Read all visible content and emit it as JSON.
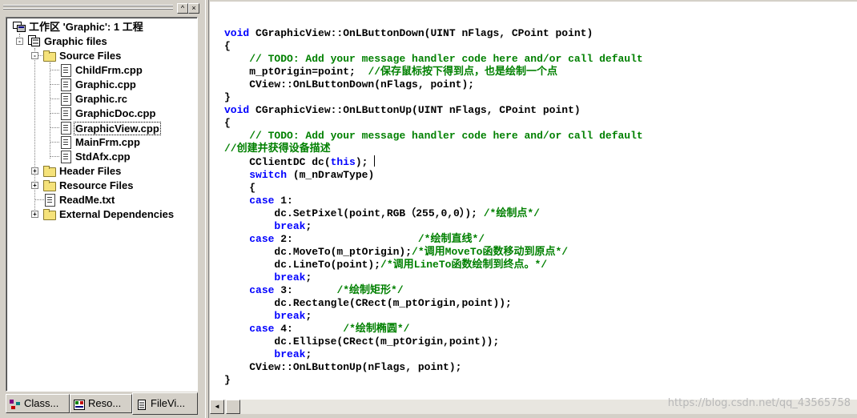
{
  "workspace": {
    "close_btn": "×",
    "pin_btn": "^",
    "root": "工作区 'Graphic': 1 工程",
    "project": "Graphic files",
    "source_folder": "Source Files",
    "source_files": [
      "ChildFrm.cpp",
      "Graphic.cpp",
      "Graphic.rc",
      "GraphicDoc.cpp",
      "GraphicView.cpp",
      "MainFrm.cpp",
      "StdAfx.cpp"
    ],
    "header_folder": "Header Files",
    "resource_folder": "Resource Files",
    "readme": "ReadMe.txt",
    "deps_folder": "External Dependencies",
    "expanded": "-",
    "collapsed": "+"
  },
  "tabs": [
    {
      "label": "Class...",
      "icon": "classview-icon"
    },
    {
      "label": "Reso...",
      "icon": "resourceview-icon"
    },
    {
      "label": "FileVi...",
      "icon": "fileview-icon"
    }
  ],
  "editor": {
    "lines": [
      [
        {
          "t": "void",
          "c": "kw"
        },
        {
          "t": " CGraphicView::OnLButtonDown(UINT nFlags, CPoint point)"
        }
      ],
      [
        {
          "t": "{"
        }
      ],
      [
        {
          "t": "    "
        },
        {
          "t": "// TODO: Add your message handler code here and/or call default",
          "c": "cm"
        }
      ],
      [
        {
          "t": "    m_ptOrigin=point;  "
        },
        {
          "t": "//保存鼠标按下得到点，也是绘制一个点",
          "c": "cm"
        }
      ],
      [
        {
          "t": "    CView::OnLButtonDown(nFlags, point);"
        }
      ],
      [
        {
          "t": "}"
        }
      ],
      [
        {
          "t": "void",
          "c": "kw"
        },
        {
          "t": " CGraphicView::OnLButtonUp(UINT nFlags, CPoint point)"
        }
      ],
      [
        {
          "t": "{"
        }
      ],
      [
        {
          "t": "    "
        },
        {
          "t": "// TODO: Add your message handler code here and/or call default",
          "c": "cm"
        }
      ],
      [
        {
          "t": "//创建并获得设备描述",
          "c": "cm"
        }
      ],
      [
        {
          "t": "    CClientDC dc("
        },
        {
          "t": "this",
          "c": "kw"
        },
        {
          "t": "); "
        },
        {
          "t": "",
          "caret": true
        }
      ],
      [
        {
          "t": "    "
        },
        {
          "t": "switch",
          "c": "kw"
        },
        {
          "t": " (m_nDrawType)"
        }
      ],
      [
        {
          "t": "    {"
        }
      ],
      [
        {
          "t": "    "
        },
        {
          "t": "case",
          "c": "kw"
        },
        {
          "t": " 1:"
        }
      ],
      [
        {
          "t": "        dc.SetPixel(point,RGB（255,0,0）); "
        },
        {
          "t": "/*绘制点*/",
          "c": "cm"
        }
      ],
      [
        {
          "t": "        "
        },
        {
          "t": "break",
          "c": "kw"
        },
        {
          "t": ";"
        }
      ],
      [
        {
          "t": "    "
        },
        {
          "t": "case",
          "c": "kw"
        },
        {
          "t": " 2:                    "
        },
        {
          "t": "/*绘制直线*/",
          "c": "cm"
        }
      ],
      [
        {
          "t": "        dc.MoveTo(m_ptOrigin);"
        },
        {
          "t": "/*调用MoveTo函数移动到原点*/",
          "c": "cm"
        }
      ],
      [
        {
          "t": "        dc.LineTo(point);"
        },
        {
          "t": "/*调用LineTo函数绘制到终点。*/",
          "c": "cm"
        }
      ],
      [
        {
          "t": "        "
        },
        {
          "t": "break",
          "c": "kw"
        },
        {
          "t": ";"
        }
      ],
      [
        {
          "t": "    "
        },
        {
          "t": "case",
          "c": "kw"
        },
        {
          "t": " 3:       "
        },
        {
          "t": "/*绘制矩形*/",
          "c": "cm"
        }
      ],
      [
        {
          "t": "        dc.Rectangle(CRect(m_ptOrigin,point));"
        }
      ],
      [
        {
          "t": "        "
        },
        {
          "t": "break",
          "c": "kw"
        },
        {
          "t": ";"
        }
      ],
      [
        {
          "t": "    "
        },
        {
          "t": "case",
          "c": "kw"
        },
        {
          "t": " 4:        "
        },
        {
          "t": "/*绘制椭圆*/",
          "c": "cm"
        }
      ],
      [
        {
          "t": "        dc.Ellipse(CRect(m_ptOrigin,point));"
        }
      ],
      [
        {
          "t": "        "
        },
        {
          "t": "break",
          "c": "kw"
        },
        {
          "t": ";"
        }
      ],
      [
        {
          "t": "    CView::OnLButtonUp(nFlags, point);"
        }
      ],
      [
        {
          "t": "}"
        }
      ]
    ]
  },
  "scroll": {
    "left_arrow": "◄"
  },
  "watermark": "https://blog.csdn.net/qq_43565758",
  "colors": {
    "keyword": "#0000ff",
    "comment": "#008000",
    "panel": "#d4d0c8"
  }
}
